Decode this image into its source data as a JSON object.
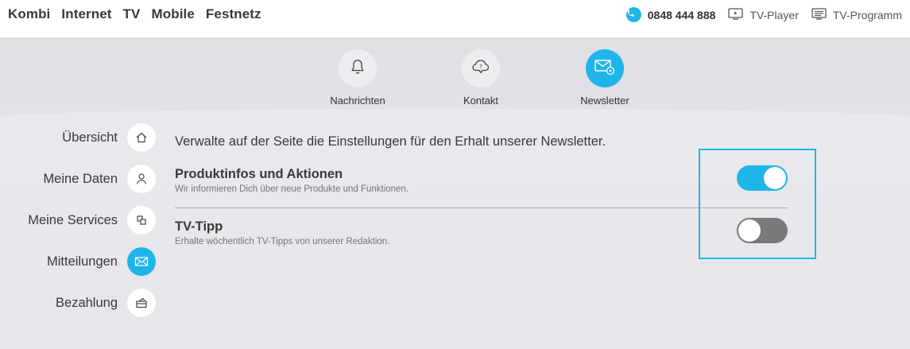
{
  "colors": {
    "accent": "#1fb5e9",
    "toggle_off": "#7a7a7a",
    "highlight": "#1fb5e9"
  },
  "header": {
    "main_nav": [
      "Kombi",
      "Internet",
      "TV",
      "Mobile",
      "Festnetz"
    ],
    "phone": {
      "icon": "phone-icon",
      "label": "0848 444 888"
    },
    "tv_player": {
      "icon": "tv-player-icon",
      "label": "TV-Player"
    },
    "tv_programm": {
      "icon": "tv-guide-icon",
      "label": "TV-Programm"
    }
  },
  "subnav": {
    "items": [
      {
        "label": "Nachrichten",
        "icon": "bell-icon",
        "active": false
      },
      {
        "label": "Kontakt",
        "icon": "help-cloud-icon",
        "active": false
      },
      {
        "label": "Newsletter",
        "icon": "newsletter-icon",
        "active": true
      }
    ]
  },
  "sidebar": {
    "items": [
      {
        "label": "Übersicht",
        "icon": "home-icon",
        "active": false
      },
      {
        "label": "Meine Daten",
        "icon": "user-icon",
        "active": false
      },
      {
        "label": "Meine Services",
        "icon": "services-icon",
        "active": false
      },
      {
        "label": "Mitteilungen",
        "icon": "mail-icon",
        "active": true
      },
      {
        "label": "Bezahlung",
        "icon": "payment-icon",
        "active": false
      }
    ]
  },
  "main": {
    "intro": "Verwalte auf der Seite die Einstellungen für den Erhalt unserer Newsletter.",
    "settings": [
      {
        "title": "Produktinfos und Aktionen",
        "description": "Wir informieren Dich über neue Produkte und Funktionen.",
        "enabled": true
      },
      {
        "title": "TV-Tipp",
        "description": "Erhalte wöchentlich TV-Tipps von unserer Redaktion.",
        "enabled": false
      }
    ]
  }
}
